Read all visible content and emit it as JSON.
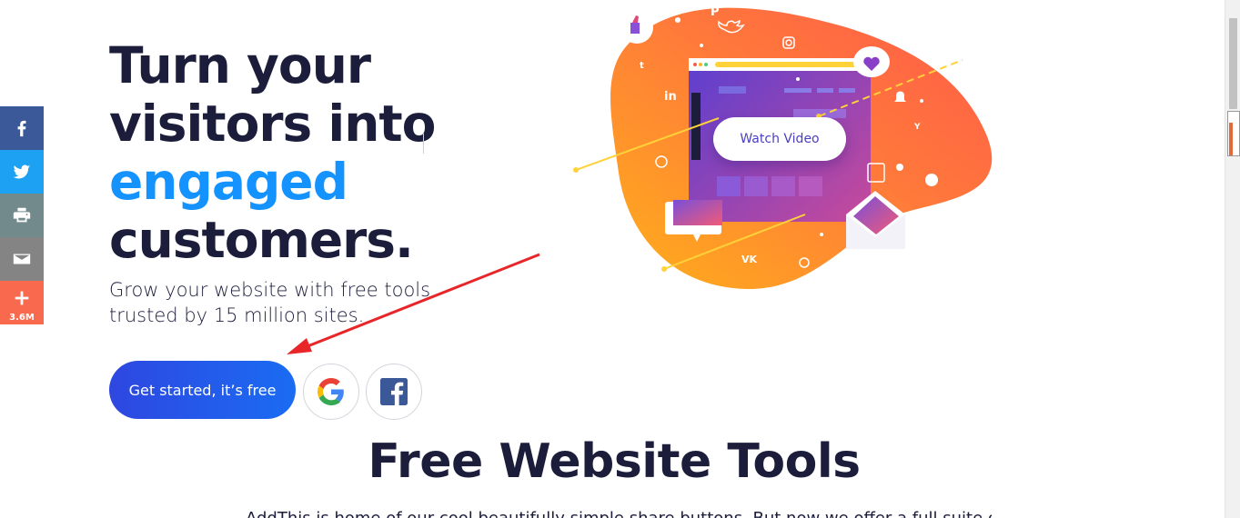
{
  "share_bar": {
    "items": [
      {
        "name": "facebook",
        "icon": "facebook-icon",
        "color": "#3b5998"
      },
      {
        "name": "twitter",
        "icon": "twitter-icon",
        "color": "#1da1f2"
      },
      {
        "name": "print",
        "icon": "printer-icon",
        "color": "#738a8d"
      },
      {
        "name": "email",
        "icon": "envelope-icon",
        "color": "#848484"
      },
      {
        "name": "more",
        "icon": "plus-icon",
        "color": "#f8694d"
      }
    ],
    "count": "3.6M"
  },
  "hero": {
    "title_line1": "Turn your",
    "title_line2": "visitors into",
    "title_line3": "engaged",
    "title_line4": "customers.",
    "subtitle_line1": "Grow your website with free tools",
    "subtitle_line2": "trusted by 15 million sites.",
    "cta_label": "Get started, it’s free",
    "google_icon": "google-icon",
    "facebook_icon": "facebook-square-icon"
  },
  "illustration": {
    "watch_video_label": "Watch Video"
  },
  "section": {
    "title": "Free Website Tools",
    "desc": "AddThis is home of our cool beautifully simple share buttons. But now we offer a full suite of"
  },
  "colors": {
    "accent": "#1493ff",
    "text": "#1c1d3b",
    "cta_start": "#2e47e0",
    "cta_end": "#1a6cf2"
  }
}
